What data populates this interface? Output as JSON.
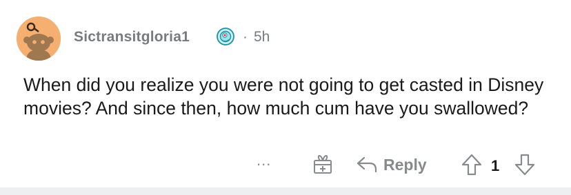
{
  "comment": {
    "author": "Sictransitgloria1",
    "separator": "·",
    "time": "5h",
    "text": "When did you realize you were not going to get casted in Disney movies? And since then, how much cum have you swallowed?"
  },
  "actions": {
    "more": "...",
    "reply_label": "Reply",
    "score": "1"
  },
  "icons": {
    "avatar": "snoo-avatar",
    "flair": "flair-badge-icon",
    "award": "gift-award-icon",
    "reply": "reply-arrow-icon",
    "upvote": "upvote-arrow-icon",
    "downvote": "downvote-arrow-icon"
  },
  "colors": {
    "avatar_bg": "#f5b071",
    "meta_text": "#787c7e",
    "body_text": "#1a1a1b",
    "icon_gray": "#878a8c",
    "divider": "#edeff1"
  }
}
